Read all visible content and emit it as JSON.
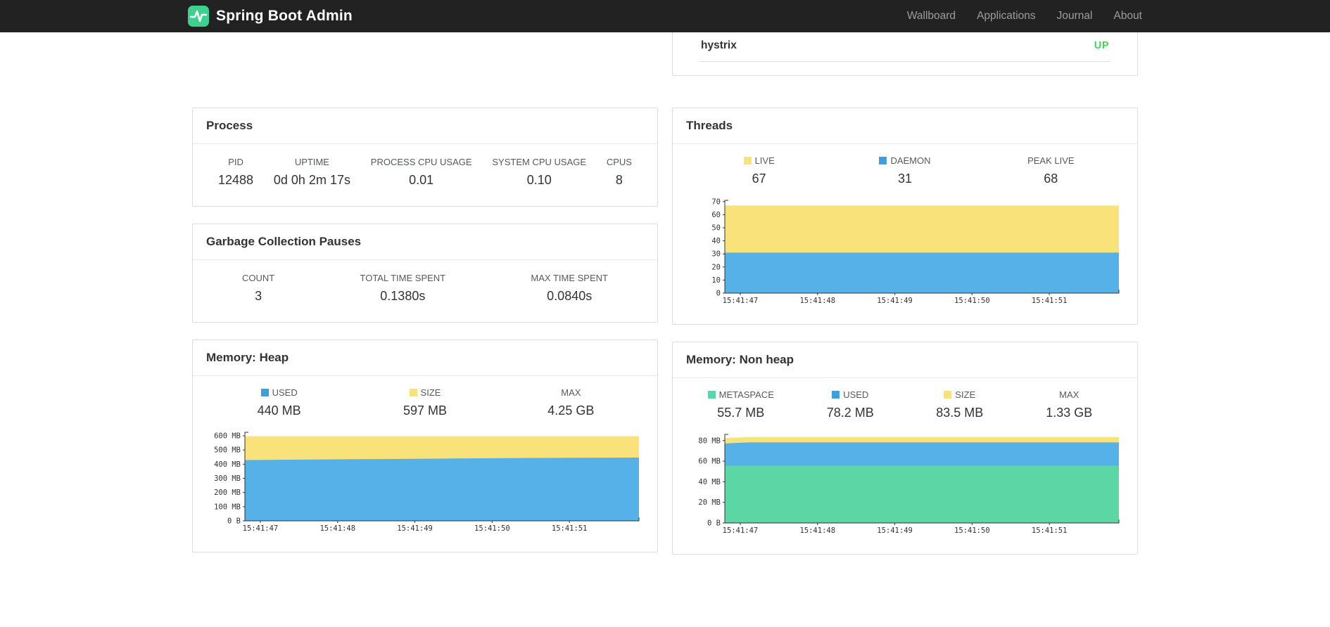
{
  "navbar": {
    "brand": "Spring Boot Admin",
    "links": [
      {
        "label": "Wallboard"
      },
      {
        "label": "Applications"
      },
      {
        "label": "Journal"
      },
      {
        "label": "About"
      }
    ]
  },
  "colors": {
    "navbar_bg": "#222222",
    "brand_icon_green": "#3ed08e",
    "nav_link_gray": "#9d9d9d",
    "status_up_green": "#42d35c",
    "chart_yellow": "#f9e27a",
    "chart_blue": "#55b1e8",
    "legend_blue": "#3e9fdd",
    "chart_green": "#5cd6a5",
    "axis_color": "#333333"
  },
  "applications_panel": {
    "instance_name": "hystrix",
    "status": "UP"
  },
  "process": {
    "title": "Process",
    "stats": [
      {
        "label": "PID",
        "value": "12488"
      },
      {
        "label": "UPTIME",
        "value": "0d 0h 2m 17s"
      },
      {
        "label": "PROCESS CPU USAGE",
        "value": "0.01"
      },
      {
        "label": "SYSTEM CPU USAGE",
        "value": "0.10"
      },
      {
        "label": "CPUS",
        "value": "8"
      }
    ]
  },
  "gc": {
    "title": "Garbage Collection Pauses",
    "stats": [
      {
        "label": "COUNT",
        "value": "3"
      },
      {
        "label": "TOTAL TIME SPENT",
        "value": "0.1380s"
      },
      {
        "label": "MAX TIME SPENT",
        "value": "0.0840s"
      }
    ]
  },
  "threads": {
    "title": "Threads",
    "legend": [
      {
        "label": "LIVE",
        "value": "67",
        "color": "#f9e27a"
      },
      {
        "label": "DAEMON",
        "value": "31",
        "color": "#3e9fdd"
      },
      {
        "label": "PEAK LIVE",
        "value": "68"
      }
    ]
  },
  "memory_heap": {
    "title": "Memory: Heap",
    "legend": [
      {
        "label": "USED",
        "value": "440 MB",
        "color": "#3e9fdd"
      },
      {
        "label": "SIZE",
        "value": "597 MB",
        "color": "#f9e27a"
      },
      {
        "label": "MAX",
        "value": "4.25 GB"
      }
    ]
  },
  "memory_nonheap": {
    "title": "Memory: Non heap",
    "legend": [
      {
        "label": "METASPACE",
        "value": "55.7 MB",
        "color": "#5cd6a5"
      },
      {
        "label": "USED",
        "value": "78.2 MB",
        "color": "#3e9fdd"
      },
      {
        "label": "SIZE",
        "value": "83.5 MB",
        "color": "#f9e27a"
      },
      {
        "label": "MAX",
        "value": "1.33 GB"
      }
    ]
  },
  "chart_data": [
    {
      "id": "threads",
      "type": "area",
      "title": "Threads",
      "grid": false,
      "legend_position": "top",
      "x_range": [
        46.8,
        51.9
      ],
      "y_max": 71,
      "x_ticks": [
        {
          "value": 47,
          "label": "15:41:47"
        },
        {
          "value": 48,
          "label": "15:41:48"
        },
        {
          "value": 49,
          "label": "15:41:49"
        },
        {
          "value": 50,
          "label": "15:41:50"
        },
        {
          "value": 51,
          "label": "15:41:51"
        }
      ],
      "y_ticks": [
        {
          "value": 0,
          "label": "0"
        },
        {
          "value": 10,
          "label": "10"
        },
        {
          "value": 20,
          "label": "20"
        },
        {
          "value": 30,
          "label": "30"
        },
        {
          "value": 40,
          "label": "40"
        },
        {
          "value": 50,
          "label": "50"
        },
        {
          "value": 60,
          "label": "60"
        },
        {
          "value": 70,
          "label": "70"
        }
      ],
      "series": [
        {
          "name": "LIVE",
          "color": "#f9e27a",
          "points": [
            [
              46.8,
              67
            ],
            [
              51.9,
              67
            ]
          ]
        },
        {
          "name": "DAEMON",
          "color": "#55b1e8",
          "points": [
            [
              46.8,
              31
            ],
            [
              51.9,
              31
            ]
          ]
        }
      ]
    },
    {
      "id": "memory-heap",
      "type": "area",
      "title": "Memory: Heap",
      "grid": false,
      "legend_position": "top",
      "x_range": [
        46.8,
        51.9
      ],
      "y_max": 625,
      "x_ticks": [
        {
          "value": 47,
          "label": "15:41:47"
        },
        {
          "value": 48,
          "label": "15:41:48"
        },
        {
          "value": 49,
          "label": "15:41:49"
        },
        {
          "value": 50,
          "label": "15:41:50"
        },
        {
          "value": 51,
          "label": "15:41:51"
        }
      ],
      "y_ticks": [
        {
          "value": 0,
          "label": "0 B"
        },
        {
          "value": 100,
          "label": "100 MB"
        },
        {
          "value": 200,
          "label": "200 MB"
        },
        {
          "value": 300,
          "label": "300 MB"
        },
        {
          "value": 400,
          "label": "400 MB"
        },
        {
          "value": 500,
          "label": "500 MB"
        },
        {
          "value": 600,
          "label": "600 MB"
        }
      ],
      "series": [
        {
          "name": "SIZE",
          "color": "#f9e27a",
          "points": [
            [
              46.8,
              597
            ],
            [
              51.9,
              597
            ]
          ]
        },
        {
          "name": "USED",
          "color": "#55b1e8",
          "points": [
            [
              46.8,
              429
            ],
            [
              47.5,
              432
            ],
            [
              48.5,
              436
            ],
            [
              49.5,
              440
            ],
            [
              50.5,
              444
            ],
            [
              51.9,
              447
            ]
          ]
        }
      ]
    },
    {
      "id": "memory-nonheap",
      "type": "area",
      "title": "Memory: Non heap",
      "grid": false,
      "legend_position": "top",
      "x_range": [
        46.8,
        51.9
      ],
      "y_max": 86,
      "x_ticks": [
        {
          "value": 47,
          "label": "15:41:47"
        },
        {
          "value": 48,
          "label": "15:41:48"
        },
        {
          "value": 49,
          "label": "15:41:49"
        },
        {
          "value": 50,
          "label": "15:41:50"
        },
        {
          "value": 51,
          "label": "15:41:51"
        }
      ],
      "y_ticks": [
        {
          "value": 0,
          "label": "0 B"
        },
        {
          "value": 20,
          "label": "20 MB"
        },
        {
          "value": 40,
          "label": "40 MB"
        },
        {
          "value": 60,
          "label": "60 MB"
        },
        {
          "value": 80,
          "label": "80 MB"
        }
      ],
      "series": [
        {
          "name": "SIZE",
          "color": "#f9e27a",
          "points": [
            [
              46.8,
              82.4
            ],
            [
              47.1,
              83.5
            ],
            [
              51.9,
              83.5
            ]
          ]
        },
        {
          "name": "USED",
          "color": "#55b1e8",
          "points": [
            [
              46.8,
              77.2
            ],
            [
              47.1,
              78.2
            ],
            [
              51.9,
              78.2
            ]
          ]
        },
        {
          "name": "METASPACE",
          "color": "#5cd6a5",
          "points": [
            [
              46.8,
              55.7
            ],
            [
              51.9,
              55.7
            ]
          ]
        }
      ]
    }
  ]
}
